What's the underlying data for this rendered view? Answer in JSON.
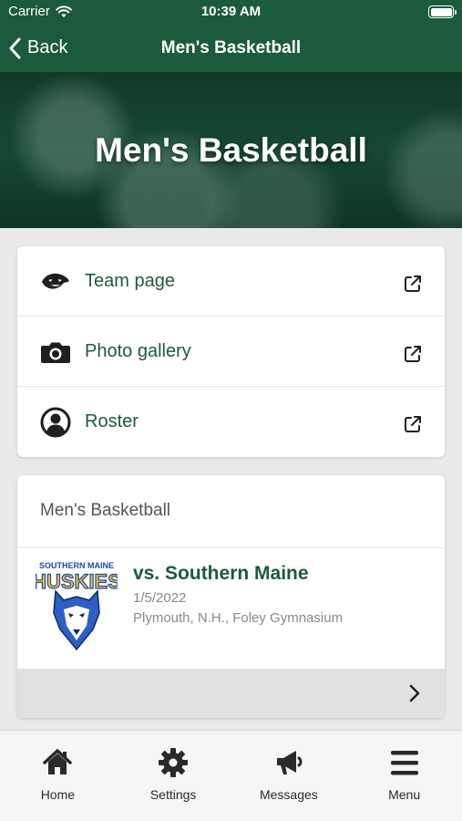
{
  "status": {
    "carrier": "Carrier",
    "time": "10:39 AM"
  },
  "nav": {
    "back_label": "Back",
    "title": "Men's Basketball"
  },
  "hero": {
    "title": "Men's Basketball"
  },
  "links": [
    {
      "label": "Team page",
      "icon": "panther-logo-icon"
    },
    {
      "label": "Photo gallery",
      "icon": "camera-icon"
    },
    {
      "label": "Roster",
      "icon": "user-circle-icon"
    }
  ],
  "game_card": {
    "section_title": "Men's Basketball",
    "logo_text_top": "SOUTHERN MAINE",
    "logo_text_main": "HUSKIES",
    "opponent": "vs. Southern Maine",
    "date": "1/5/2022",
    "location": "Plymouth, N.H., Foley Gymnasium"
  },
  "tabs": [
    {
      "label": "Home",
      "icon": "home-icon"
    },
    {
      "label": "Settings",
      "icon": "gear-icon"
    },
    {
      "label": "Messages",
      "icon": "megaphone-icon"
    },
    {
      "label": "Menu",
      "icon": "menu-icon"
    }
  ],
  "colors": {
    "brand": "#1c5a3c",
    "background": "#e9e9e9",
    "muted": "#8a8a8a"
  }
}
